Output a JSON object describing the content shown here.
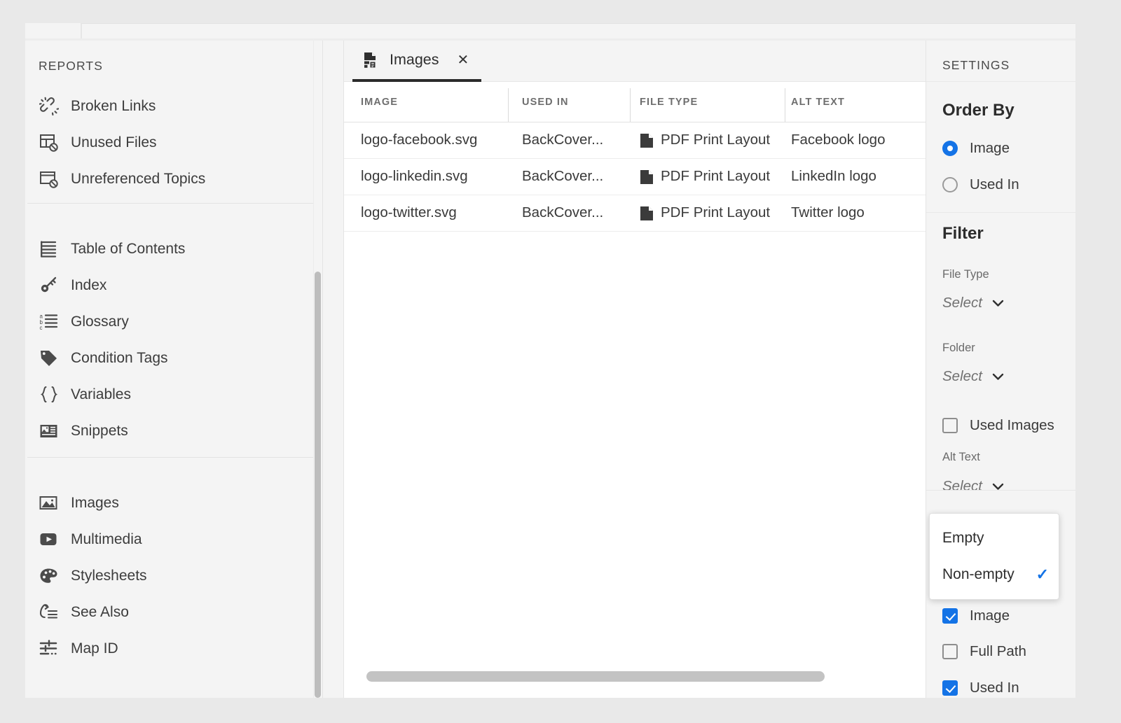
{
  "sidebar": {
    "title": "REPORTS",
    "groups": [
      {
        "items": [
          {
            "label": "Broken Links",
            "icon": "broken-link-icon"
          },
          {
            "label": "Unused Files",
            "icon": "unused-files-icon"
          },
          {
            "label": "Unreferenced Topics",
            "icon": "unreferenced-topics-icon"
          }
        ]
      },
      {
        "items": [
          {
            "label": "Table of Contents",
            "icon": "toc-icon"
          },
          {
            "label": "Index",
            "icon": "key-icon"
          },
          {
            "label": "Glossary",
            "icon": "glossary-icon"
          },
          {
            "label": "Condition Tags",
            "icon": "tag-icon"
          },
          {
            "label": "Variables",
            "icon": "braces-icon"
          },
          {
            "label": "Snippets",
            "icon": "snippet-icon"
          }
        ]
      },
      {
        "items": [
          {
            "label": "Images",
            "icon": "image-icon"
          },
          {
            "label": "Multimedia",
            "icon": "video-icon"
          },
          {
            "label": "Stylesheets",
            "icon": "palette-icon"
          },
          {
            "label": "See Also",
            "icon": "see-also-icon"
          },
          {
            "label": "Map ID",
            "icon": "map-id-icon"
          }
        ]
      }
    ]
  },
  "main": {
    "tab": {
      "label": "Images",
      "icon": "report-file-icon",
      "close": "✕"
    },
    "table": {
      "columns": [
        "IMAGE",
        "USED IN",
        "FILE TYPE",
        "ALT TEXT"
      ],
      "rows": [
        {
          "image": "logo-facebook.svg",
          "used_in": "BackCover...",
          "file_type": "PDF Print Layout",
          "file_type_icon": "document-icon",
          "alt_text": "Facebook logo"
        },
        {
          "image": "logo-linkedin.svg",
          "used_in": "BackCover...",
          "file_type": "PDF Print Layout",
          "file_type_icon": "document-icon",
          "alt_text": "LinkedIn logo"
        },
        {
          "image": "logo-twitter.svg",
          "used_in": "BackCover...",
          "file_type": "PDF Print Layout",
          "file_type_icon": "document-icon",
          "alt_text": "Twitter logo"
        }
      ]
    }
  },
  "settings": {
    "title": "SETTINGS",
    "order_by": {
      "heading": "Order By",
      "options": [
        {
          "label": "Image",
          "selected": true
        },
        {
          "label": "Used In",
          "selected": false
        }
      ]
    },
    "filter": {
      "heading": "Filter",
      "file_type": {
        "label": "File Type",
        "value": "Select",
        "caret": "chevron-down-icon"
      },
      "folder": {
        "label": "Folder",
        "value": "Select",
        "caret": "chevron-down-icon"
      },
      "used_images": {
        "label": "Used Images",
        "checked": false
      },
      "alt_text": {
        "label": "Alt Text",
        "value": "Select",
        "caret": "chevron-down-icon"
      },
      "dropdown": {
        "options": [
          {
            "label": "Empty",
            "checked": false
          },
          {
            "label": "Non-empty",
            "checked": true,
            "check_glyph": "✓"
          }
        ]
      },
      "columns": [
        {
          "label": "Image",
          "checked": true
        },
        {
          "label": "Full Path",
          "checked": false
        },
        {
          "label": "Used In",
          "checked": true
        }
      ]
    }
  },
  "colors": {
    "accent": "#1473e6",
    "panel_bg": "#f4f4f4",
    "content_bg": "#ffffff",
    "text": "#3a3a3a",
    "muted": "#6e6e6e",
    "tab_underline": "#2b2b2b"
  }
}
